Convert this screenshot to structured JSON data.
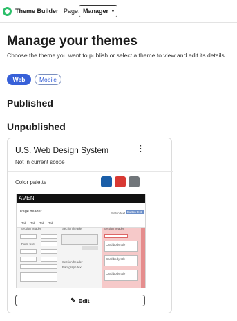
{
  "topbar": {
    "app_name": "Theme Builder",
    "page_label": "Page:",
    "page_value": "Manager"
  },
  "header": {
    "title": "Manage your themes",
    "subtitle": "Choose the theme you want to publish or select a theme to view and edit its details."
  },
  "platform_tabs": [
    "Web",
    "Mobile"
  ],
  "sections": {
    "published": "Published",
    "unpublished": "Unpublished"
  },
  "theme_card": {
    "title": "U.S. Web Design System",
    "scope": "Not in current scope",
    "palette_label": "Color palette",
    "palette_colors": [
      "#1a5ea8",
      "#d83933",
      "#71767a"
    ],
    "edit_label": "Edit",
    "preview": {
      "brand": "AVEN",
      "page_header": "Page header",
      "button_text": "Button text",
      "button_label": "Button text",
      "tabs": [
        "Tab",
        "Tab",
        "Tab",
        "Tab"
      ],
      "section_header": "Section header",
      "form_text": "Form text",
      "card_body_title": "Card body title",
      "paragraph_text": "Paragraph text"
    }
  }
}
